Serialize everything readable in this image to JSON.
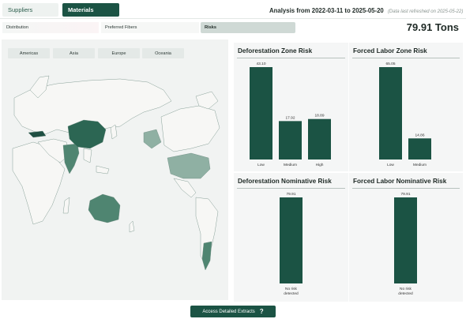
{
  "tabs": {
    "suppliers": "Suppliers",
    "materials": "Materials"
  },
  "header": {
    "analysis": "Analysis from 2022-03-11 to 2025-05-20",
    "refreshed": "(Data last refreshed on 2025-05-22)",
    "total": "79.91 Tons"
  },
  "subtabs": {
    "distribution": "Distribution",
    "preferred": "Preferred Fibers",
    "risks": "Risks"
  },
  "regions": [
    "Americas",
    "Asia",
    "Europe",
    "Oceania"
  ],
  "colors": {
    "brand": "#1b5344",
    "map_dark": "#2c6653",
    "map_mid": "#4f8571",
    "map_light": "#8fb0a3",
    "map_base": "#f7f7f5"
  },
  "cta": {
    "label": "Access Detailed Extracts",
    "icon": "?"
  },
  "chart_data": [
    {
      "type": "bar",
      "title": "Deforestation Zone Risk",
      "categories": [
        "Low",
        "Medium",
        "High"
      ],
      "values": [
        43.1,
        17.92,
        18.89
      ]
    },
    {
      "type": "bar",
      "title": "Forced Labor Zone Risk",
      "categories": [
        "Low",
        "Medium"
      ],
      "values": [
        65.05,
        14.86
      ]
    },
    {
      "type": "bar",
      "title": "Deforestation Nominative Risk",
      "categories": [
        "No risk detected"
      ],
      "values": [
        79.91
      ]
    },
    {
      "type": "bar",
      "title": "Forced Labor Nominative Risk",
      "categories": [
        "No risk detected"
      ],
      "values": [
        79.91
      ]
    }
  ]
}
